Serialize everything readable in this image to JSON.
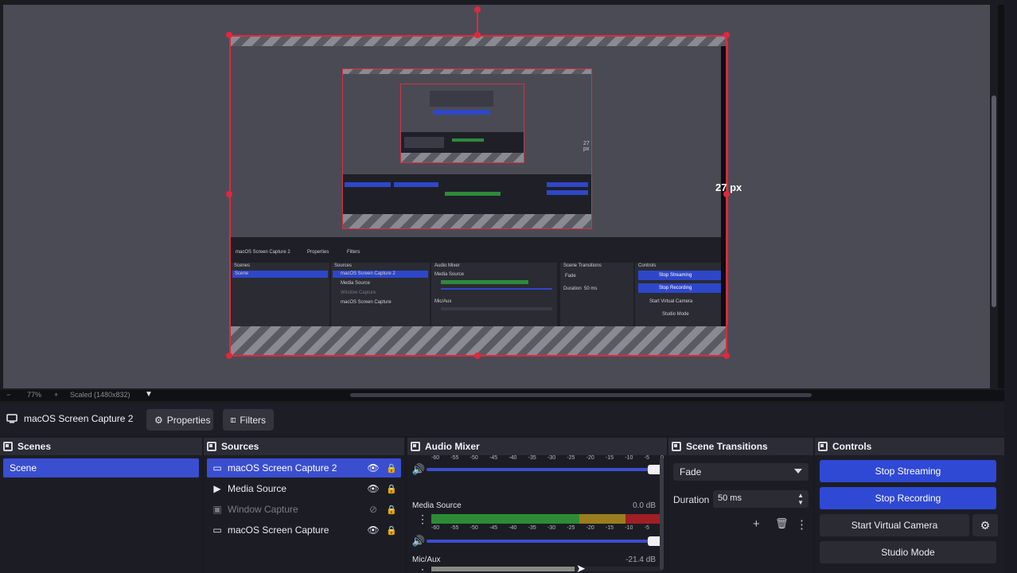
{
  "preview": {
    "distance_label": "27 px",
    "nested_distance_label": "27 px",
    "zoom_minus": "−",
    "zoom_level": "77%",
    "zoom_plus": "+",
    "scale_mode": "Scaled (1480x832)"
  },
  "source_toolbar": {
    "current_source": "macOS Screen Capture 2",
    "properties_label": "Properties",
    "filters_label": "Filters"
  },
  "scenes": {
    "title": "Scenes",
    "items": [
      "Scene"
    ]
  },
  "sources": {
    "title": "Sources",
    "items": [
      {
        "label": "macOS Screen Capture 2",
        "icon": "monitor-icon",
        "selected": true,
        "visible": true
      },
      {
        "label": "Media Source",
        "icon": "play-icon",
        "selected": false,
        "visible": true
      },
      {
        "label": "Window Capture",
        "icon": "window-icon",
        "selected": false,
        "visible": false
      },
      {
        "label": "macOS Screen Capture",
        "icon": "monitor-icon",
        "selected": false,
        "visible": true
      }
    ]
  },
  "audio_mixer": {
    "title": "Audio Mixer",
    "scale": [
      "-60",
      "-55",
      "-50",
      "-45",
      "-40",
      "-35",
      "-30",
      "-25",
      "-20",
      "-15",
      "-10",
      "-5",
      "0"
    ],
    "channels": [
      {
        "name": "Media Source",
        "db": "0.0 dB"
      },
      {
        "name": "Mic/Aux",
        "db": "-21.4 dB"
      }
    ]
  },
  "scene_transitions": {
    "title": "Scene Transitions",
    "transition": "Fade",
    "duration_label": "Duration",
    "duration_value": "50 ms"
  },
  "controls": {
    "title": "Controls",
    "stop_streaming": "Stop Streaming",
    "stop_recording": "Stop Recording",
    "start_virtual_camera": "Start Virtual Camera",
    "studio_mode": "Studio Mode"
  },
  "nested_ui": {
    "current_source": "macOS Screen Capture 2",
    "properties": "Properties",
    "filters": "Filters",
    "scenes": "Scenes",
    "scene": "Scene",
    "sources": "Sources",
    "src1": "macOS Screen Capture 2",
    "src2": "Media Source",
    "src3": "Window Capture",
    "src4": "macOS Screen Capture",
    "mixer": "Audio Mixer",
    "media_source": "Media Source",
    "mic_aux": "Mic/Aux",
    "transitions": "Scene Transitions",
    "fade": "Fade",
    "duration": "Duration",
    "duration_value": "50 ms",
    "controls": "Controls",
    "stop_streaming": "Stop Streaming",
    "stop_recording": "Stop Recording",
    "start_virtual_camera": "Start Virtual Camera",
    "studio_mode": "Studio Mode"
  },
  "colors": {
    "accent": "#3a4ed0",
    "selection_outline": "#e0283c",
    "panel_header": "#2b2c35"
  }
}
